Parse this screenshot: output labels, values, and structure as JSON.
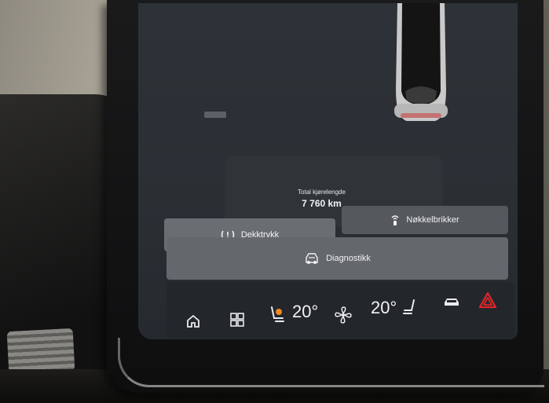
{
  "vehicle_info": {
    "odometer_label": "Total kjørelengde",
    "odometer_value": "7 760 km"
  },
  "tiles": {
    "tire_pressure_label": "Dekktrykk",
    "key_fobs_label": "Nøkkelbrikker",
    "diagnostics_label": "Diagnostikk"
  },
  "taskbar": {
    "driver_temp": "20°",
    "passenger_temp": "20°",
    "icons": [
      "home-icon",
      "apps-grid-icon",
      "driver-seat-heat-icon",
      "fan-icon",
      "passenger-seat-icon",
      "car-icon",
      "hazard-icon"
    ]
  },
  "colors": {
    "screen_bg": "#2d3238",
    "tile_bg": "#5f6367",
    "hazard_red": "#e0262a",
    "seat_heat_orange": "#f08a24"
  }
}
